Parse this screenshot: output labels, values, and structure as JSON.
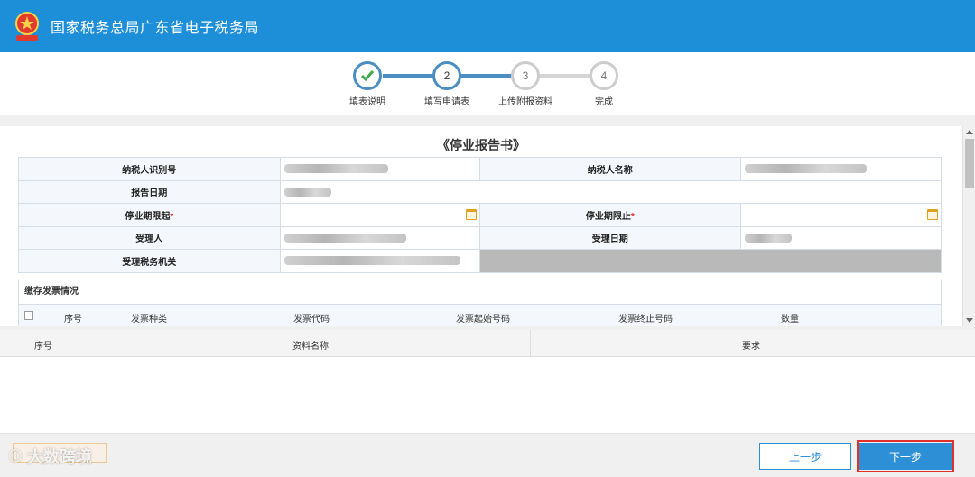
{
  "header": {
    "title": "国家税务总局广东省电子税务局"
  },
  "steps": [
    {
      "num": "✓",
      "label": "填表说明",
      "state": "done"
    },
    {
      "num": "2",
      "label": "填写申请表",
      "state": "current"
    },
    {
      "num": "3",
      "label": "上传附报资料",
      "state": "todo"
    },
    {
      "num": "4",
      "label": "完成",
      "state": "todo"
    }
  ],
  "form": {
    "title": "《停业报告书》",
    "taxpayer_id_label": "纳税人识别号",
    "taxpayer_name_label": "纳税人名称",
    "report_date_label": "报告日期",
    "suspend_start_label": "停业期限起",
    "suspend_end_label": "停业期限止",
    "required_mark": "*",
    "acceptor_label": "受理人",
    "accept_date_label": "受理日期",
    "tax_office_label": "受理税务机关",
    "invoice_section_title": "缴存发票情况",
    "invoice_columns": [
      "序号",
      "发票种类",
      "发票代码",
      "发票起始号码",
      "发票终止号码",
      "数量"
    ]
  },
  "attachments": {
    "columns": [
      "序号",
      "资料名称",
      "要求"
    ]
  },
  "footer": {
    "prev_label": "上一步",
    "next_label": "下一步",
    "watermark": "大数跨境"
  },
  "colors": {
    "brand": "#1d8fd8",
    "step_active": "#4a8ec2",
    "button": "#2d8fd6",
    "highlight": "#e0312b"
  }
}
